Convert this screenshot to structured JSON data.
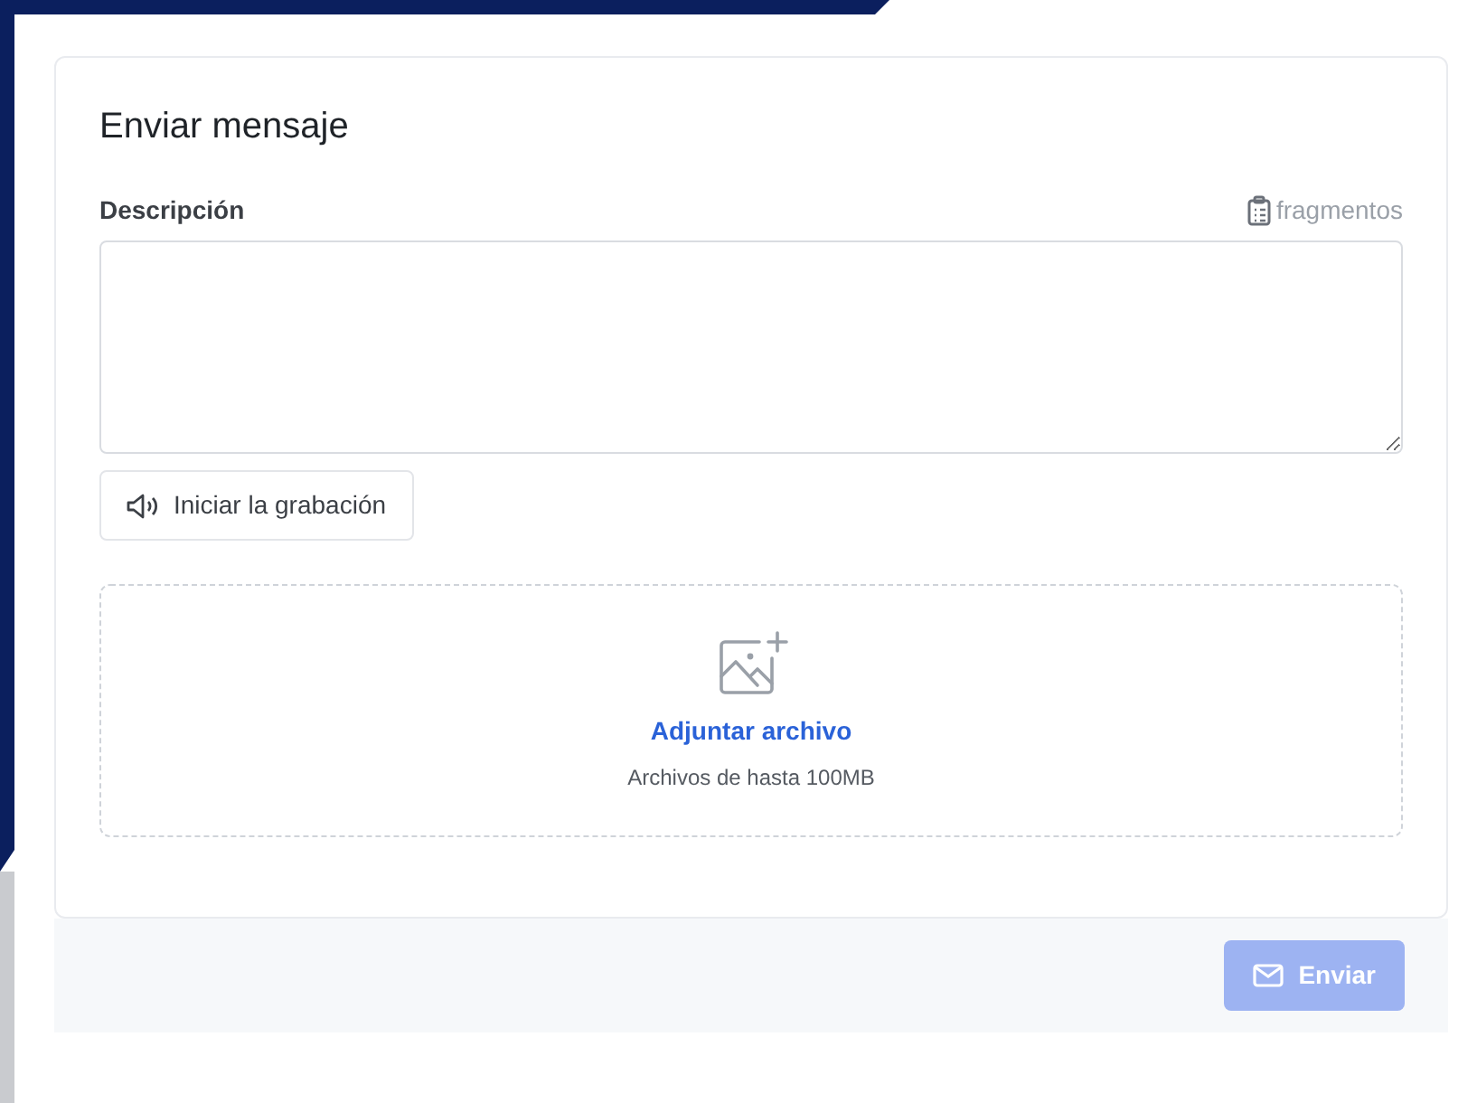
{
  "form": {
    "title": "Enviar mensaje",
    "description": {
      "label": "Descripción",
      "snippets_link": "fragmentos"
    },
    "record_button": {
      "label": "Iniciar la grabación"
    },
    "attachment": {
      "link": "Adjuntar archivo",
      "hint": "Archivos de hasta 100MB"
    },
    "submit_button": {
      "label": "Enviar",
      "disabled": true
    }
  }
}
